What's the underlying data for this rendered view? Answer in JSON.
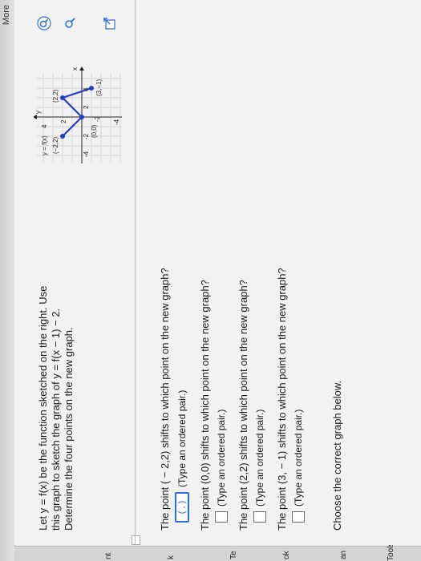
{
  "question": {
    "line1": "Let y = f(x) be the function sketched on the right. Use",
    "line2": "this graph to sketch the graph of y = f(x − 1) − 2.",
    "line3": "Determine the four points on the new graph."
  },
  "graph": {
    "label_func": "y = f(x)",
    "point_a": "(−2,2)",
    "point_b": "(2,2)",
    "point_c": "(0,0)",
    "point_d": "(3,−1)",
    "tick_4": "4",
    "tick_2": "2",
    "tick_neg4": "-4",
    "tick_neg2": "-2",
    "tick_x2": "2",
    "tick_x4": "4",
    "axis_y": "y",
    "axis_x": "x"
  },
  "parts": [
    {
      "prompt": "The point ( − 2,2) shifts to which point on the new graph?",
      "value": "( , )",
      "hint": "(Type an ordered pair.)"
    },
    {
      "prompt": "The point (0,0) shifts to which point on the new graph?",
      "value": "",
      "hint": "(Type an ordered pair.)"
    },
    {
      "prompt": "The point (2,2) shifts to which point on the new graph?",
      "value": "",
      "hint": "(Type an ordered pair.)"
    },
    {
      "prompt": "The point (3, − 1) shifts to which point on the new graph?",
      "value": "",
      "hint": "(Type an ordered pair.)"
    }
  ],
  "choose": "Choose the correct graph below.",
  "sidebar": {
    "item1": "nt",
    "item2": "k",
    "item3": "Te",
    "item4": "ok",
    "item5": "an",
    "item6": "Tools"
  },
  "topbar": {
    "more": "More"
  },
  "colors": {
    "accent": "#2b6fd6",
    "graph_line": "#2340c8"
  }
}
